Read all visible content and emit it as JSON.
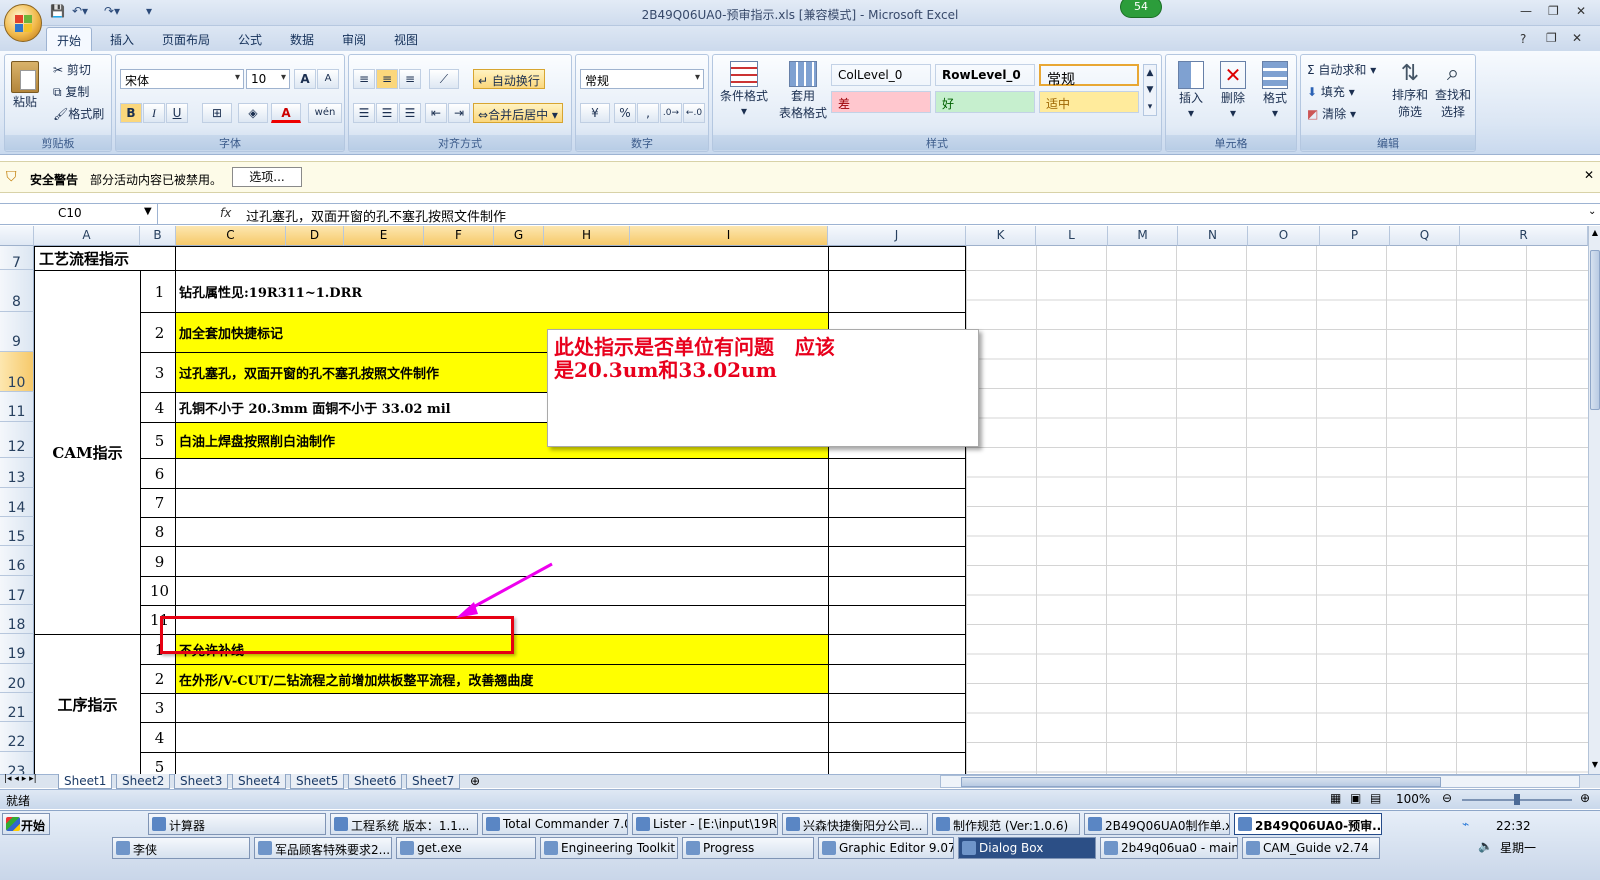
{
  "window": {
    "title": "2B49Q06UA0-预审指示.xls  [兼容模式] - Microsoft Excel",
    "badge": "54"
  },
  "ribbon_tabs": [
    "开始",
    "插入",
    "页面布局",
    "公式",
    "数据",
    "审阅",
    "视图"
  ],
  "clipboard": {
    "paste": "粘贴",
    "cut": "剪切",
    "copy": "复制",
    "format_painter": "格式刷",
    "label": "剪贴板"
  },
  "font": {
    "name": "宋体",
    "size": "10",
    "label": "字体",
    "bold": "B",
    "italic": "I",
    "underline": "U",
    "grow": "A",
    "shrink": "A",
    "color_a": "A",
    "wen": "wén"
  },
  "alignment": {
    "wrap": "自动换行",
    "merge": "合并后居中",
    "label": "对齐方式"
  },
  "number": {
    "format": "常规",
    "label": "数字",
    "percent": "%",
    "comma": ","
  },
  "styles": {
    "conditional": "条件格式",
    "table": "套用",
    "table2": "表格格式",
    "cells": [
      {
        "text": "ColLevel_0",
        "bg": "#ffffff",
        "fg": "#000000"
      },
      {
        "text": "RowLevel_0",
        "bg": "#ffffff",
        "fg": "#000000"
      },
      {
        "text": "常规",
        "bg": "#ffffff",
        "fg": "#000000"
      },
      {
        "text": "差",
        "bg": "#ffc7ce",
        "fg": "#9c0006"
      },
      {
        "text": "好",
        "bg": "#c6efce",
        "fg": "#006100"
      },
      {
        "text": "适中",
        "bg": "#ffeb9c",
        "fg": "#9c6500"
      }
    ],
    "label": "样式"
  },
  "cells_group": {
    "insert": "插入",
    "delete": "删除",
    "format": "格式",
    "label": "单元格"
  },
  "editing": {
    "autosum": "自动求和",
    "fill": "填充",
    "clear": "清除",
    "sort": "排序和",
    "sort2": "筛选",
    "find": "查找和",
    "find2": "选择",
    "label": "编辑"
  },
  "security": {
    "title": "安全警告",
    "message": "部分活动内容已被禁用。",
    "options": "选项..."
  },
  "formula": {
    "name_box": "C10",
    "fx": "fx",
    "content": "过孔塞孔，双面开窗的孔不塞孔按照文件制作"
  },
  "columns": [
    "A",
    "B",
    "C",
    "D",
    "E",
    "F",
    "G",
    "H",
    "I",
    "J",
    "K",
    "L",
    "M",
    "N",
    "O",
    "P",
    "Q",
    "R"
  ],
  "rows": [
    "7",
    "8",
    "9",
    "10",
    "11",
    "12",
    "13",
    "14",
    "15",
    "16",
    "17",
    "18",
    "19",
    "20",
    "21",
    "22",
    "23"
  ],
  "sheet": {
    "header_title": "工艺流程指示",
    "cam_label": "CAM指示",
    "process_label": "工序指示",
    "cam_items": [
      {
        "n": "1",
        "text": "钻孔属性见:19R311~1.DRR",
        "yellow": false
      },
      {
        "n": "2",
        "text": "加全套加快捷标记",
        "yellow": true
      },
      {
        "n": "3",
        "text": "过孔塞孔，双面开窗的孔不塞孔按照文件制作",
        "yellow": true
      },
      {
        "n": "4",
        "text": "孔铜不小于  20.3mm   面铜不小于  33.02 mil",
        "yellow": false
      },
      {
        "n": "5",
        "text": "白油上焊盘按照削白油制作",
        "yellow": true
      },
      {
        "n": "6",
        "text": "",
        "yellow": false
      },
      {
        "n": "7",
        "text": "",
        "yellow": false
      },
      {
        "n": "8",
        "text": "",
        "yellow": false
      },
      {
        "n": "9",
        "text": "",
        "yellow": false
      },
      {
        "n": "10",
        "text": "",
        "yellow": false
      },
      {
        "n": "11",
        "text": "",
        "yellow": false
      }
    ],
    "process_items": [
      {
        "n": "1",
        "text": "不允许补线",
        "yellow": true
      },
      {
        "n": "2",
        "text": "在外形/V-CUT/二钻流程之前增加烘板整平流程，改善翘曲度",
        "yellow": true
      },
      {
        "n": "3",
        "text": "",
        "yellow": false
      },
      {
        "n": "4",
        "text": "",
        "yellow": false
      },
      {
        "n": "5",
        "text": "",
        "yellow": false
      }
    ]
  },
  "callout": "此处指示是否单位有问题   应该\n是20.3um和33.02um",
  "sheet_tabs": [
    "Sheet1",
    "Sheet2",
    "Sheet3",
    "Sheet4",
    "Sheet5",
    "Sheet6",
    "Sheet7"
  ],
  "status": {
    "ready": "就绪",
    "zoom": "100%"
  },
  "taskbar": {
    "start": "开始",
    "row1": [
      "计算器",
      "工程系统  版本：1.1...",
      "Total Commander 7.0 p...",
      "Lister - [E:\\input\\19R3...",
      "兴森快捷衡阳分公司...",
      "制作规范 (Ver:1.0.6)",
      "2B49Q06UA0制作单.xl...",
      "2B49Q06UA0-预审..."
    ],
    "row2": [
      "李侠",
      "军品顾客特殊要求2...",
      "get.exe",
      "Engineering Toolkit 9....",
      "Progress",
      "Graphic Editor 9.07b...",
      "Dialog Box",
      "2b49q06ua0 - main_qa",
      "CAM_Guide v2.74"
    ],
    "time": "22:32",
    "day": "星期一"
  }
}
